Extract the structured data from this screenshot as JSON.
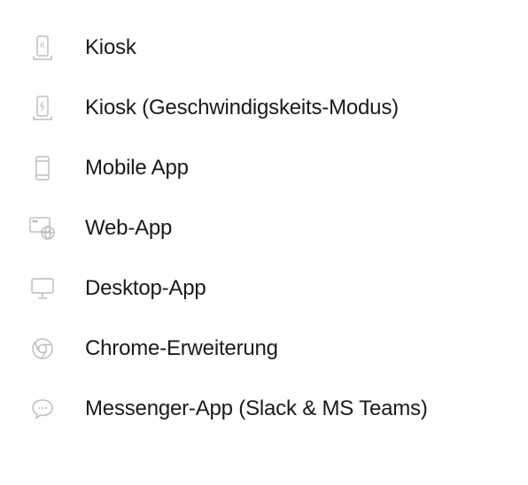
{
  "menu": {
    "items": [
      {
        "label": "Kiosk",
        "icon": "kiosk-icon"
      },
      {
        "label": "Kiosk (Geschwindigskeits-Modus)",
        "icon": "kiosk-speed-icon"
      },
      {
        "label": "Mobile App",
        "icon": "mobile-icon"
      },
      {
        "label": "Web-App",
        "icon": "web-app-icon"
      },
      {
        "label": "Desktop-App",
        "icon": "desktop-icon"
      },
      {
        "label": "Chrome-Erweiterung",
        "icon": "chrome-icon"
      },
      {
        "label": "Messenger-App (Slack & MS Teams)",
        "icon": "messenger-icon"
      }
    ]
  }
}
